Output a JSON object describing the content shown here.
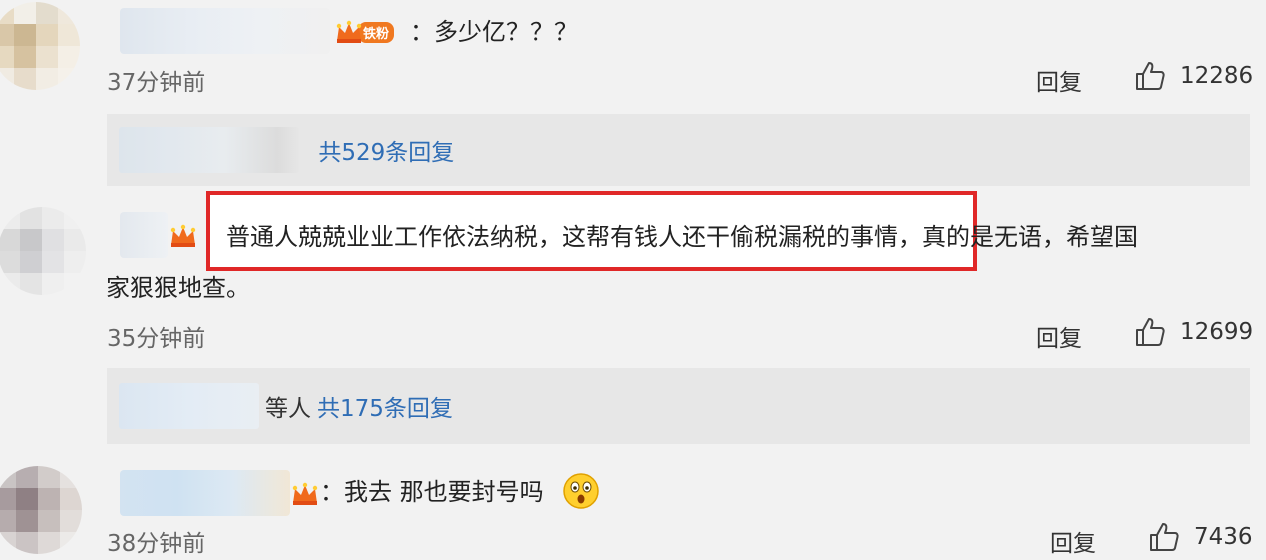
{
  "comments": [
    {
      "text": "：多少亿？？？",
      "time": "37分钟前",
      "reply_label": "回复",
      "likes": "12286",
      "badge": "铁粉",
      "replies": {
        "prefix": "",
        "link": "共529条回复"
      }
    },
    {
      "text_line1": "普通人兢兢业业工作依法纳税，这帮有钱人还干偷税漏税的事情，真的是无语，希望国",
      "text_line2": "家狠狠地查。",
      "time": "35分钟前",
      "reply_label": "回复",
      "likes": "12699",
      "replies": {
        "prefix": "等人",
        "link": "共175条回复"
      }
    },
    {
      "text": "：我去 那也要封号吗",
      "time": "38分钟前",
      "reply_label": "回复",
      "likes": "7436"
    }
  ],
  "colors": {
    "background": "#f2f2f2",
    "reply_box": "#e7e7e7",
    "link": "#2f6db5",
    "highlight": "#e02828",
    "badge": "#f07820"
  }
}
